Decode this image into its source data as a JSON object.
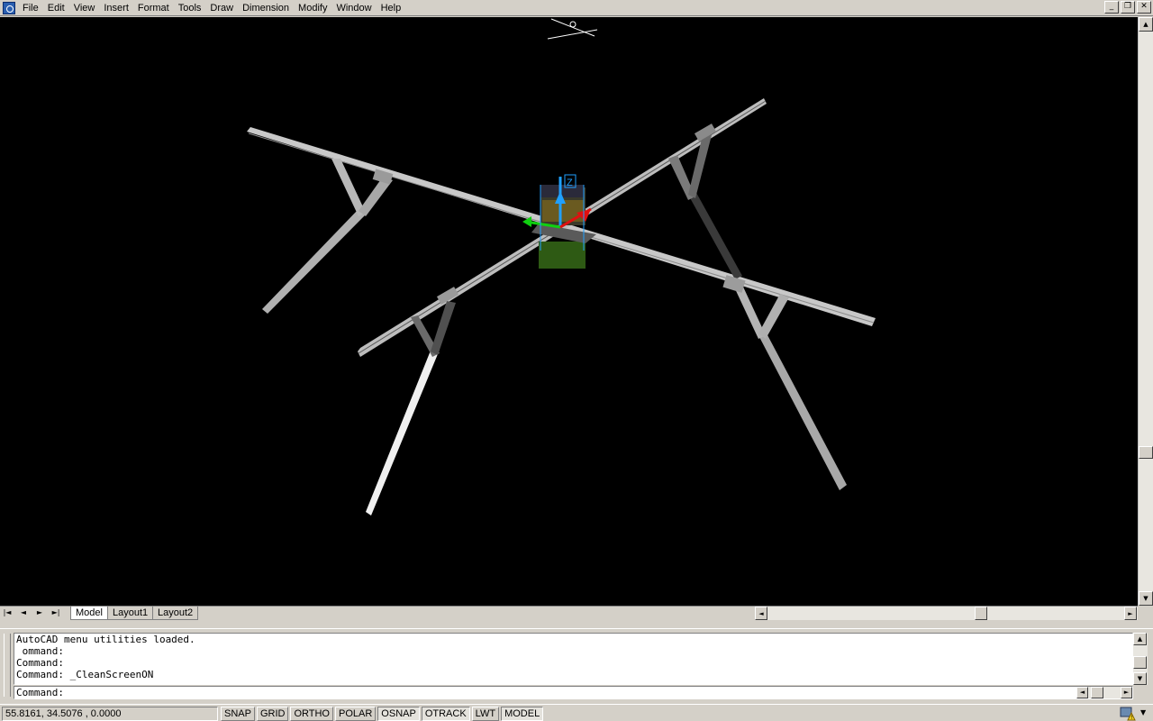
{
  "menubar": {
    "items": [
      "File",
      "Edit",
      "View",
      "Insert",
      "Format",
      "Tools",
      "Draw",
      "Dimension",
      "Modify",
      "Window",
      "Help"
    ]
  },
  "window_controls": {
    "minimize": "_",
    "restore": "❐",
    "close": "✕"
  },
  "icons": {
    "app": "autocad-app-icon",
    "ucs": "ucs-axis-icon",
    "gizmo": "3d-orbit-gizmo-icon",
    "tray": "balloon-warning-icon"
  },
  "colors": {
    "viewport_bg": "#000000",
    "frame": "#c8c8c8",
    "gizmo_x": "#e01010",
    "gizmo_y": "#10d010",
    "gizmo_z": "#20a0ff"
  },
  "gizmo": {
    "z_label": "Z"
  },
  "tabs": {
    "nav": [
      "|◄",
      "◄",
      "►",
      "►|"
    ],
    "items": [
      {
        "label": "Model",
        "active": true
      },
      {
        "label": "Layout1",
        "active": false
      },
      {
        "label": "Layout2",
        "active": false
      }
    ]
  },
  "command": {
    "history": [
      "AutoCAD menu utilities loaded.",
      " ommand:",
      "Command:",
      "Command: _CleanScreenON"
    ],
    "prompt": "Command:"
  },
  "status": {
    "coordinates": "55.8161,  34.5076 , 0.0000",
    "toggles": [
      {
        "label": "SNAP",
        "on": false
      },
      {
        "label": "GRID",
        "on": false
      },
      {
        "label": "ORTHO",
        "on": false
      },
      {
        "label": "POLAR",
        "on": false
      },
      {
        "label": "OSNAP",
        "on": true
      },
      {
        "label": "OTRACK",
        "on": true
      },
      {
        "label": "LWT",
        "on": false
      },
      {
        "label": "MODEL",
        "on": true
      }
    ]
  }
}
